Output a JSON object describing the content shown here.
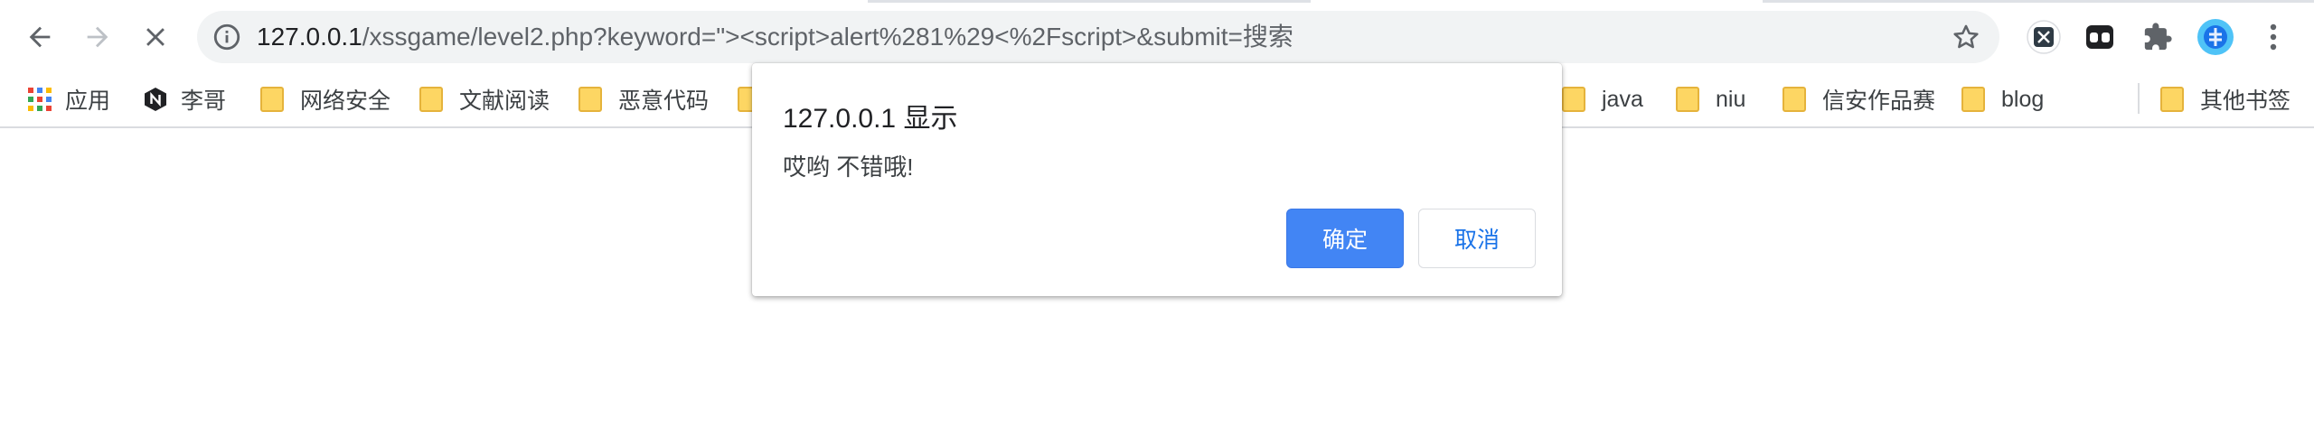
{
  "browser": {
    "url_host": "127.0.0.1",
    "url_rest": "/xssgame/level2.php?keyword=\"><script>alert%281%29<%2Fscript>&submit=搜索"
  },
  "bookmarks": [
    {
      "label": "应用",
      "icon": "apps-grid-icon"
    },
    {
      "label": "李哥",
      "icon": "n-logo-icon"
    },
    {
      "label": "网络安全",
      "icon": "folder-icon"
    },
    {
      "label": "文献阅读",
      "icon": "folder-icon"
    },
    {
      "label": "恶意代码",
      "icon": "folder-icon"
    },
    {
      "label": "java",
      "icon": "folder-icon"
    },
    {
      "label": "niu",
      "icon": "folder-icon"
    },
    {
      "label": "信安作品赛",
      "icon": "folder-icon"
    },
    {
      "label": "blog",
      "icon": "folder-icon"
    },
    {
      "label": "其他书签",
      "icon": "folder-icon"
    }
  ],
  "dialog": {
    "title": "127.0.0.1 显示",
    "message": "哎哟 不错哦!",
    "ok_label": "确定",
    "cancel_label": "取消"
  },
  "colors": {
    "accent": "#4285f4",
    "folder": "#fdd663",
    "omnibox_bg": "#f1f3f4"
  }
}
